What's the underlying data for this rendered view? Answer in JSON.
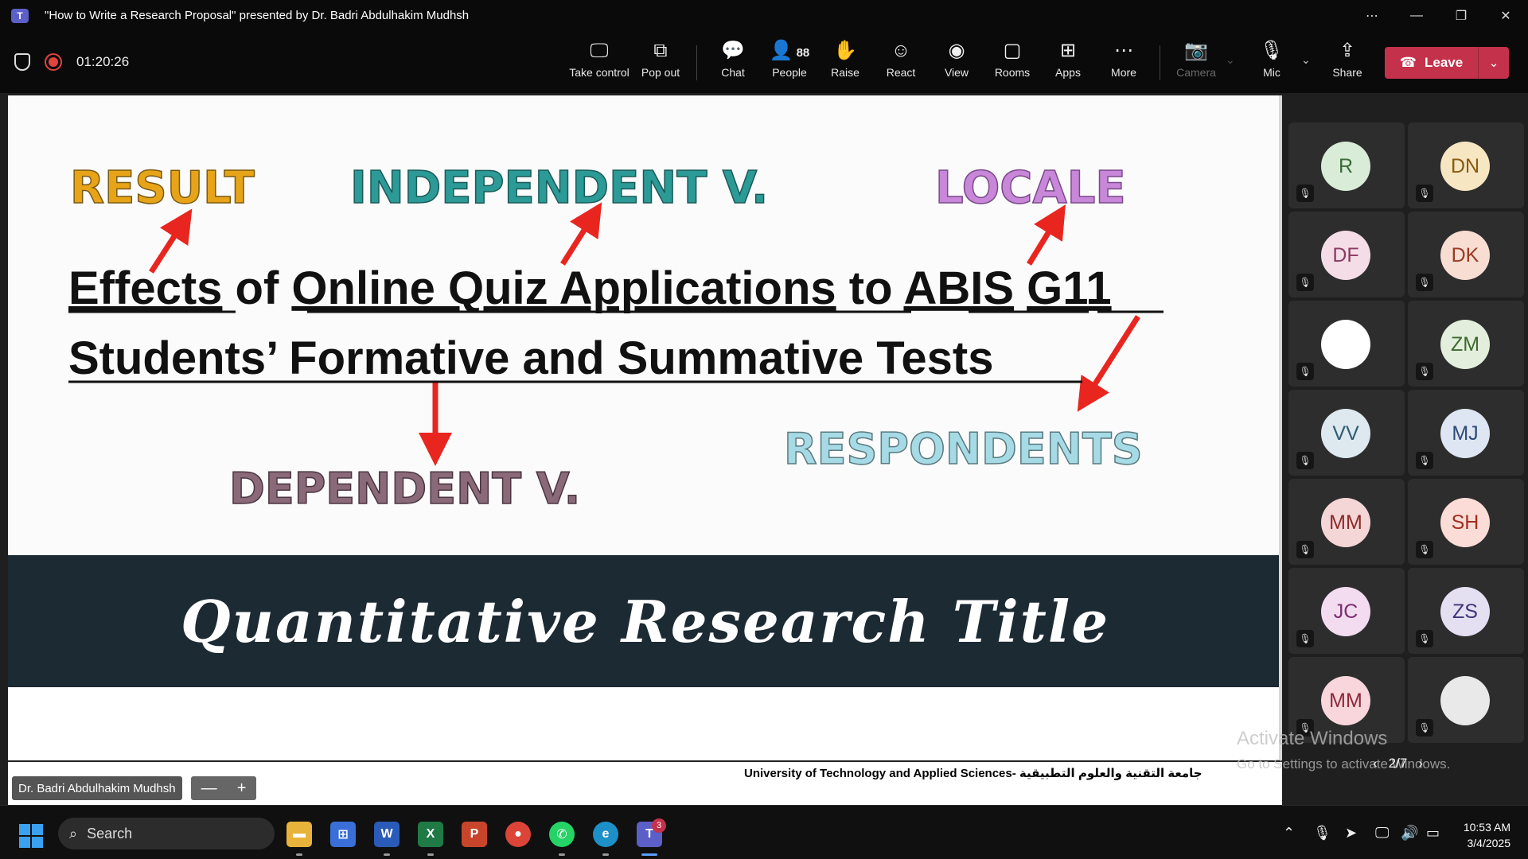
{
  "window": {
    "title": "\"How to Write a Research Proposal\" presented by Dr. Badri Abdulhakim Mudhsh",
    "controls": [
      "⋯",
      "—",
      "❐",
      "✕"
    ]
  },
  "meeting": {
    "timer": "01:20:26",
    "buttons": {
      "take_control": "Take control",
      "pop_out": "Pop out",
      "chat": "Chat",
      "people": "People",
      "people_count": "88",
      "raise": "Raise",
      "react": "React",
      "view": "View",
      "rooms": "Rooms",
      "apps": "Apps",
      "more": "More",
      "camera": "Camera",
      "mic": "Mic",
      "share": "Share",
      "leave": "Leave"
    }
  },
  "slide": {
    "labels": {
      "result": "RESULT",
      "independent": "INDEPENDENT V.",
      "locale": "LOCALE",
      "respondents": "RESPONDENTS",
      "dependent": "DEPENDENT V."
    },
    "title_line1": {
      "w1": "Effects",
      "w2": "of",
      "w3": "Online Quiz Applications",
      "w4": "to",
      "w5": "ABIS",
      "w6": "G11"
    },
    "title_line2": "Students’ Formative and Summative Tests",
    "band_title": "Quantitative Research Title",
    "colors": {
      "result": "#e8a418",
      "independent": "#2c9a96",
      "locale": "#c887d8",
      "respondents": "#a6dbe6",
      "dependent": "#8a6a78",
      "arrow": "#e8261f",
      "band": "#1c2a33"
    }
  },
  "presenter": {
    "name": "Dr. Badri Abdulhakim Mudhsh",
    "zoom_out": "—",
    "zoom_in": "+"
  },
  "institution": "University of Technology and Applied Sciences- جامعة التقنية والعلوم التطبيقية",
  "participants": [
    {
      "initials": "R",
      "bg": "#d8ecd8",
      "fg": "#3a6b3a"
    },
    {
      "initials": "DN",
      "bg": "#f6e6c2",
      "fg": "#8a5a10"
    },
    {
      "initials": "DF",
      "bg": "#f5dde8",
      "fg": "#8a3a60"
    },
    {
      "initials": "DK",
      "bg": "#f8ddd3",
      "fg": "#9a3a22"
    },
    {
      "initials": "",
      "bg": "#ffffff",
      "fg": "#333333"
    },
    {
      "initials": "ZM",
      "bg": "#e3efdc",
      "fg": "#3e6a30"
    },
    {
      "initials": "VV",
      "bg": "#dde9ef",
      "fg": "#2e5a70"
    },
    {
      "initials": "MJ",
      "bg": "#dde6f2",
      "fg": "#2e4a78"
    },
    {
      "initials": "MM",
      "bg": "#f5d6d6",
      "fg": "#8a2a2a"
    },
    {
      "initials": "SH",
      "bg": "#fbdcd6",
      "fg": "#a02e20"
    },
    {
      "initials": "JC",
      "bg": "#f3dcf0",
      "fg": "#7a2e70"
    },
    {
      "initials": "ZS",
      "bg": "#e4e0f2",
      "fg": "#3e3478"
    },
    {
      "initials": "MM",
      "bg": "#f8d6dc",
      "fg": "#8a2a3a"
    },
    {
      "initials": "",
      "bg": "#e9e9e9",
      "fg": "#333333"
    }
  ],
  "pager": {
    "prev": "‹",
    "text": "2/7",
    "next": "›"
  },
  "watermark": {
    "line1": "Activate Windows",
    "line2": "Go to Settings to activate Windows."
  },
  "taskbar": {
    "search_placeholder": "Search",
    "teams_badge": "3",
    "time": "10:53 AM",
    "date": "3/4/2025"
  }
}
